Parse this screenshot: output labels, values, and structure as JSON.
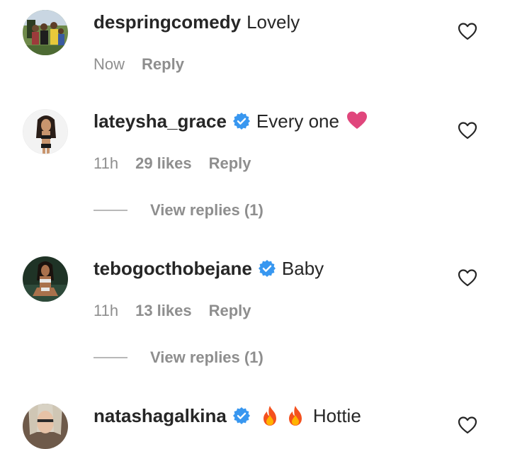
{
  "comments": [
    {
      "username": "despringcomedy",
      "text": "Lovely",
      "verified": false,
      "time": "Now",
      "likes": "",
      "reply_label": "Reply",
      "view_replies": ""
    },
    {
      "username": "lateysha_grace",
      "text": "Every one",
      "verified": true,
      "emoji": "pink-heart-emoji",
      "time": "11h",
      "likes": "29 likes",
      "reply_label": "Reply",
      "view_replies": "View replies (1)"
    },
    {
      "username": "tebogocthobejane",
      "text": "Baby",
      "verified": true,
      "time": "11h",
      "likes": "13 likes",
      "reply_label": "Reply",
      "view_replies": "View replies (1)"
    },
    {
      "username": "natashagalkina",
      "text": "Hottie",
      "verified": true,
      "emoji": "fire-emoji x2",
      "time": "",
      "likes": "",
      "reply_label": "",
      "view_replies": ""
    }
  ],
  "colors": {
    "text": "#262626",
    "secondary": "#8e8e8e",
    "verified_blue": "#3897f0",
    "heart_emoji": "#e0467c"
  },
  "icons": [
    "heart-outline-icon",
    "verified-badge-icon",
    "pink-heart-emoji",
    "fire-emoji"
  ]
}
